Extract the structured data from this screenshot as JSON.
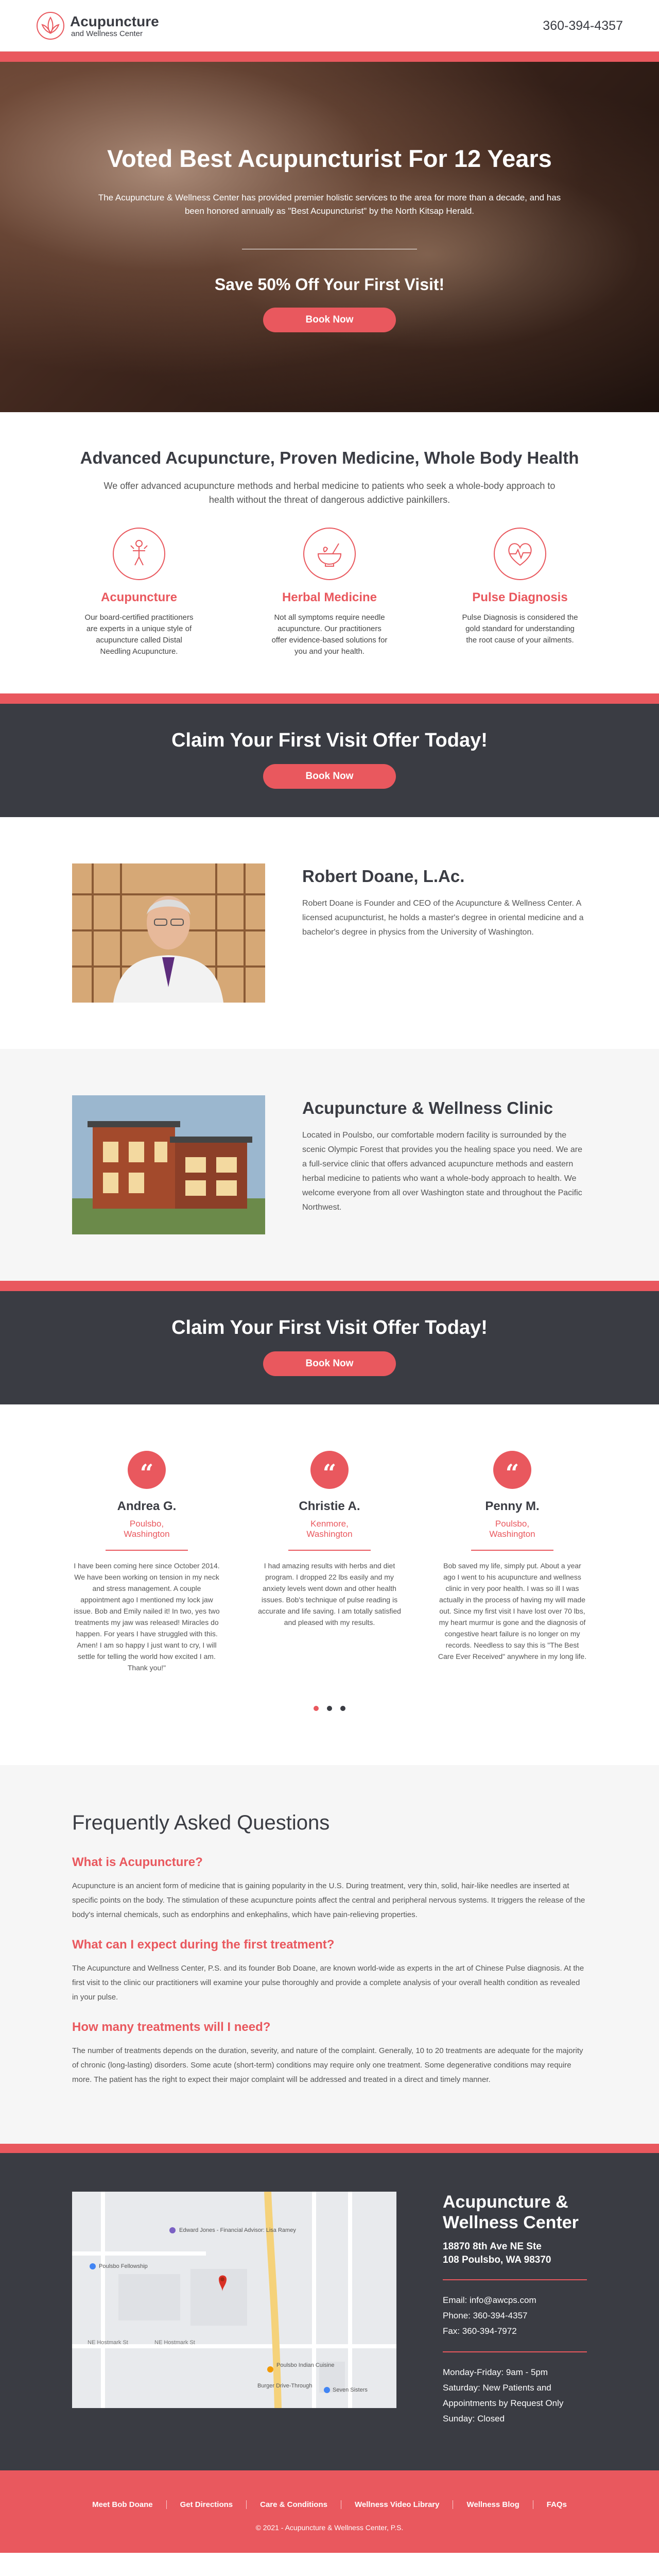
{
  "header": {
    "logo_line1": "Acupuncture",
    "logo_line2": "and Wellness Center",
    "phone": "360-394-4357"
  },
  "hero": {
    "title": "Voted Best Acupuncturist For 12 Years",
    "text": "The Acupuncture & Wellness Center has provided premier holistic services to the area for more than a decade, and has been honored annually as \"Best Acupuncturist\" by the North Kitsap Herald.",
    "offer": "Save 50% Off Your First Visit!",
    "button": "Book Now"
  },
  "features": {
    "title": "Advanced Acupuncture, Proven Medicine, Whole Body Health",
    "lead": "We offer advanced acupuncture methods and herbal medicine to patients who seek a whole-body approach to health without the threat of dangerous addictive painkillers.",
    "items": [
      {
        "icon": "acupuncture-icon",
        "title": "Acupuncture",
        "text": "Our board-certified practitioners are experts in a unique style of acupuncture called Distal Needling Acupuncture."
      },
      {
        "icon": "herbal-bowl-icon",
        "title": "Herbal Medicine",
        "text": "Not all symptoms require needle acupuncture. Our practitioners offer evidence-based solutions for you and your health."
      },
      {
        "icon": "pulse-icon",
        "title": "Pulse Diagnosis",
        "text": "Pulse Diagnosis is considered the gold standard for understanding the root cause of your ailments."
      }
    ]
  },
  "claim": {
    "title": "Claim Your First Visit Offer Today!",
    "button": "Book Now"
  },
  "doctor": {
    "name": "Robert Doane, L.Ac.",
    "text": "Robert Doane is Founder and CEO of the Acupuncture & Wellness Center. A licensed acupuncturist, he holds a master's degree in oriental medicine and a bachelor's degree in physics from the University of Washington."
  },
  "clinic": {
    "name": "Acupuncture & Wellness Clinic",
    "text": "Located in Poulsbo, our comfortable modern facility is surrounded by the scenic Olympic Forest that provides you the healing space you need. We are a full-service clinic that offers advanced acupuncture methods and eastern herbal medicine to patients who want a whole-body approach to health. We welcome everyone from all over Washington state and throughout the Pacific Northwest."
  },
  "testimonials": [
    {
      "name": "Andrea G.",
      "location": "Poulsbo, Washington",
      "text": "I have been coming here since October 2014. We have been working on tension in my neck and stress management. A couple appointment ago I mentioned my lock jaw issue. Bob and Emily nailed it! In two, yes two treatments my jaw was released! Miracles do happen. For years I have struggled with this. Amen! I am so happy I just want to cry, I will settle for telling the world how excited I am. Thank you!\""
    },
    {
      "name": "Christie A.",
      "location": "Kenmore, Washington",
      "text": "I had amazing results with herbs and diet program. I dropped 22 lbs easily and my anxiety levels went down and other health issues. Bob's technique of pulse reading is accurate and life saving. I am totally satisfied and pleased with my results."
    },
    {
      "name": "Penny M.",
      "location": "Poulsbo, Washington",
      "text": "Bob saved my life, simply put. About a year ago I went to his acupuncture and wellness clinic in very poor health. I was so ill I was actually in the process of having my will made out. Since my first visit I have lost over 70 lbs, my heart murmur is gone and the diagnosis of congestive heart failure is no longer on my records. Needless to say this is \"The Best Care Ever Received\" anywhere in my long life."
    }
  ],
  "faq": {
    "title": "Frequently Asked Questions",
    "items": [
      {
        "q": "What is Acupuncture?",
        "a": "Acupuncture is an ancient form of medicine that is gaining popularity in the U.S. During treatment, very thin, solid, hair-like needles are inserted at specific points on the body. The stimulation of these acupuncture points affect the central and peripheral nervous systems. It triggers the release of the body's internal chemicals, such as endorphins and enkephalins, which have pain-relieving properties."
      },
      {
        "q": "What can I expect during the first treatment?",
        "a": "The Acupuncture and Wellness Center, P.S. and its founder Bob Doane, are known world-wide as experts in the art of Chinese Pulse diagnosis. At the first visit to the clinic our practitioners will examine your pulse thoroughly and provide a complete analysis of your overall health condition as revealed in your pulse."
      },
      {
        "q": "How many treatments will I need?",
        "a": "The number of treatments depends on the duration, severity, and nature of the complaint. Generally, 10 to 20 treatments are adequate for the majority of chronic (long-lasting) disorders. Some acute (short-term) conditions may require only one treatment. Some degenerative conditions may require more. The patient has the right to expect their major complaint will be addressed and treated in a direct and timely manner."
      }
    ]
  },
  "map": {
    "labels": [
      "Edward Jones - Financial Advisor: Lisa Ramey",
      "Poulsbo Fellowship",
      "NE Hostmark St",
      "NE Hostmark St",
      "Poulsbo Indian Cuisine",
      "Burger Drive-Through",
      "Seven Sisters"
    ]
  },
  "footer": {
    "name": "Acupuncture & Wellness Center",
    "addr1": "18870 8th Ave NE Ste",
    "addr2": "108 Poulsbo, WA 98370",
    "email": "Email: info@awcps.com",
    "phone": "Phone: 360-394-4357",
    "fax": "Fax: 360-394-7972",
    "hours1": "Monday-Friday: 9am - 5pm",
    "hours2": "Saturday: New Patients and Appointments by Request Only",
    "hours3": "Sunday: Closed",
    "nav": [
      "Meet Bob Doane",
      "Get Directions",
      "Care & Conditions",
      "Wellness Video Library",
      "Wellness Blog",
      "FAQs"
    ],
    "copyright": "© 2021 - Acupuncture & Wellness Center, P.S."
  }
}
